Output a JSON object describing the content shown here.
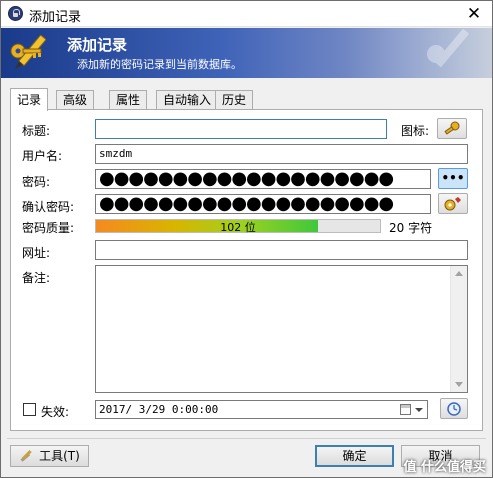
{
  "window": {
    "title": "添加记录",
    "close_glyph": "✕"
  },
  "banner": {
    "title": "添加记录",
    "subtitle": "添加新的密码记录到当前数据库。"
  },
  "tabs": [
    {
      "label": "记录",
      "active": true
    },
    {
      "label": "高级",
      "active": false
    },
    {
      "label": "属性",
      "active": false
    },
    {
      "label": "自动输入",
      "active": false
    },
    {
      "label": "历史",
      "active": false
    }
  ],
  "form": {
    "title_label": "标题:",
    "title_value": "",
    "icon_label": "图标:",
    "username_label": "用户名:",
    "username_value": "smzdm",
    "password_label": "密码:",
    "password_masked": "●●●●●●●●●●●●●●●●●●●●",
    "show_password_label": "•••",
    "repeat_label": "确认密码:",
    "repeat_masked": "●●●●●●●●●●●●●●●●●●●●",
    "quality_label": "密码质量:",
    "quality_text": "102 位",
    "quality_fraction": 0.78,
    "char_count": "20 字符",
    "url_label": "网址:",
    "url_value": "",
    "notes_label": "备注:",
    "notes_value": "",
    "expires_label": "失效:",
    "expires_checked": false,
    "expires_value": "2017/ 3/29  0:00:00"
  },
  "buttons": {
    "tools": "工具(T)",
    "ok": "确定",
    "cancel": "取消"
  },
  "watermark": "值 什么值得买"
}
